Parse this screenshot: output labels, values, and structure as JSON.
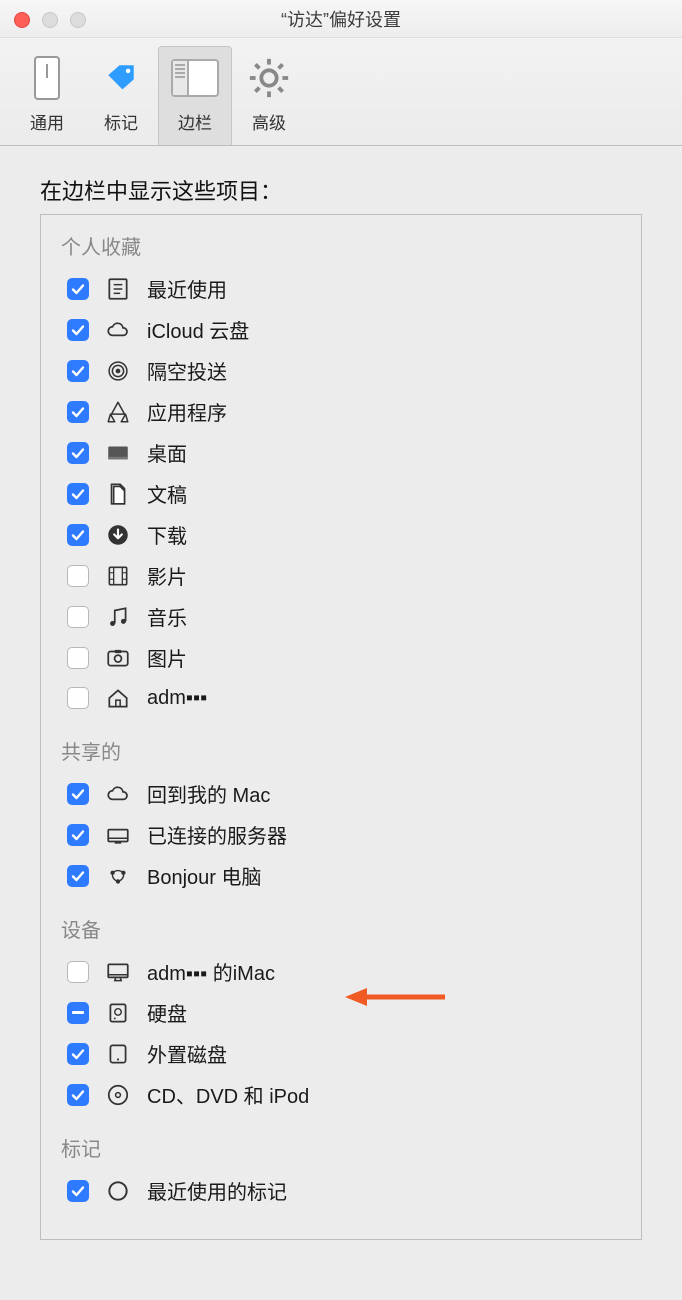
{
  "window": {
    "title": "“访达”偏好设置"
  },
  "toolbar": {
    "general": "通用",
    "tags": "标记",
    "sidebar": "边栏",
    "advanced": "高级"
  },
  "content": {
    "header": "在边栏中显示这些项目：",
    "sections": {
      "favorites": {
        "title": "个人收藏",
        "items": [
          {
            "label": "最近使用",
            "checked": true,
            "icon": "recents"
          },
          {
            "label": "iCloud 云盘",
            "checked": true,
            "icon": "cloud"
          },
          {
            "label": "隔空投送",
            "checked": true,
            "icon": "airdrop"
          },
          {
            "label": "应用程序",
            "checked": true,
            "icon": "apps"
          },
          {
            "label": "桌面",
            "checked": true,
            "icon": "desktop"
          },
          {
            "label": "文稿",
            "checked": true,
            "icon": "documents"
          },
          {
            "label": "下载",
            "checked": true,
            "icon": "downloads"
          },
          {
            "label": "影片",
            "checked": false,
            "icon": "movies"
          },
          {
            "label": "音乐",
            "checked": false,
            "icon": "music"
          },
          {
            "label": "图片",
            "checked": false,
            "icon": "pictures"
          },
          {
            "label": "adm▪▪▪",
            "checked": false,
            "icon": "home"
          }
        ]
      },
      "shared": {
        "title": "共享的",
        "items": [
          {
            "label": "回到我的 Mac",
            "checked": true,
            "icon": "cloud"
          },
          {
            "label": "已连接的服务器",
            "checked": true,
            "icon": "server"
          },
          {
            "label": "Bonjour 电脑",
            "checked": true,
            "icon": "bonjour"
          }
        ]
      },
      "devices": {
        "title": "设备",
        "items": [
          {
            "label": "adm▪▪▪ 的iMac",
            "checked": false,
            "icon": "imac"
          },
          {
            "label": "硬盘",
            "checked": "mixed",
            "icon": "hdd"
          },
          {
            "label": "外置磁盘",
            "checked": true,
            "icon": "ext"
          },
          {
            "label": "CD、DVD 和 iPod",
            "checked": true,
            "icon": "cd"
          }
        ]
      },
      "tags": {
        "title": "标记",
        "items": [
          {
            "label": "最近使用的标记",
            "checked": true,
            "icon": "tagcircle"
          }
        ]
      }
    }
  }
}
